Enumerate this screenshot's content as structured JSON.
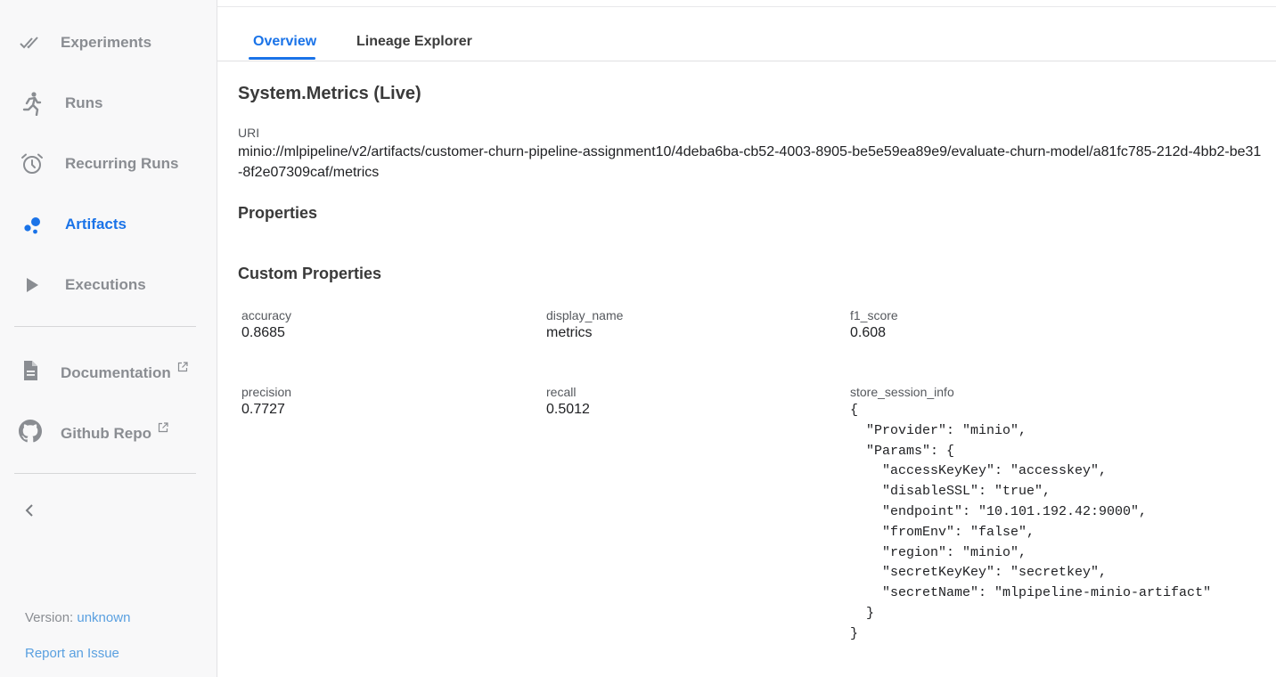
{
  "sidebar": {
    "items": [
      {
        "label": "Experiments",
        "icon": "double-check-icon",
        "active": false
      },
      {
        "label": "Runs",
        "icon": "running-person-icon",
        "active": false
      },
      {
        "label": "Recurring Runs",
        "icon": "alarm-clock-icon",
        "active": false
      },
      {
        "label": "Artifacts",
        "icon": "bubble-chart-icon",
        "active": true
      },
      {
        "label": "Executions",
        "icon": "play-arrow-icon",
        "active": false
      }
    ],
    "links": [
      {
        "label": "Documentation",
        "icon": "document-icon"
      },
      {
        "label": "Github Repo",
        "icon": "github-icon"
      }
    ],
    "version_label": "Version:",
    "version_value": "unknown",
    "report_label": "Report an Issue"
  },
  "tabs": [
    {
      "label": "Overview",
      "active": true
    },
    {
      "label": "Lineage Explorer",
      "active": false
    }
  ],
  "artifact": {
    "title": "System.Metrics (Live)",
    "uri_label": "URI",
    "uri_value": "minio://mlpipeline/v2/artifacts/customer-churn-pipeline-assignment10/4deba6ba-cb52-4003-8905-be5e59ea89e9/evaluate-churn-model/a81fc785-212d-4bb2-be31-8f2e07309caf/metrics",
    "properties_heading": "Properties",
    "custom_properties_heading": "Custom Properties",
    "custom_properties": [
      {
        "key": "accuracy",
        "value": "0.8685"
      },
      {
        "key": "display_name",
        "value": "metrics"
      },
      {
        "key": "f1_score",
        "value": "0.608"
      },
      {
        "key": "precision",
        "value": "0.7727"
      },
      {
        "key": "recall",
        "value": "0.5012"
      },
      {
        "key": "store_session_info",
        "value": "{\n  \"Provider\": \"minio\",\n  \"Params\": {\n    \"accessKeyKey\": \"accesskey\",\n    \"disableSSL\": \"true\",\n    \"endpoint\": \"10.101.192.42:9000\",\n    \"fromEnv\": \"false\",\n    \"region\": \"minio\",\n    \"secretKeyKey\": \"secretkey\",\n    \"secretName\": \"mlpipeline-minio-artifact\"\n  }\n}"
      }
    ]
  },
  "colors": {
    "accent": "#1a73e8",
    "link": "#5aa0e0",
    "nav_inactive": "#8a8d92",
    "sidebar_bg": "#f8f8f9"
  }
}
